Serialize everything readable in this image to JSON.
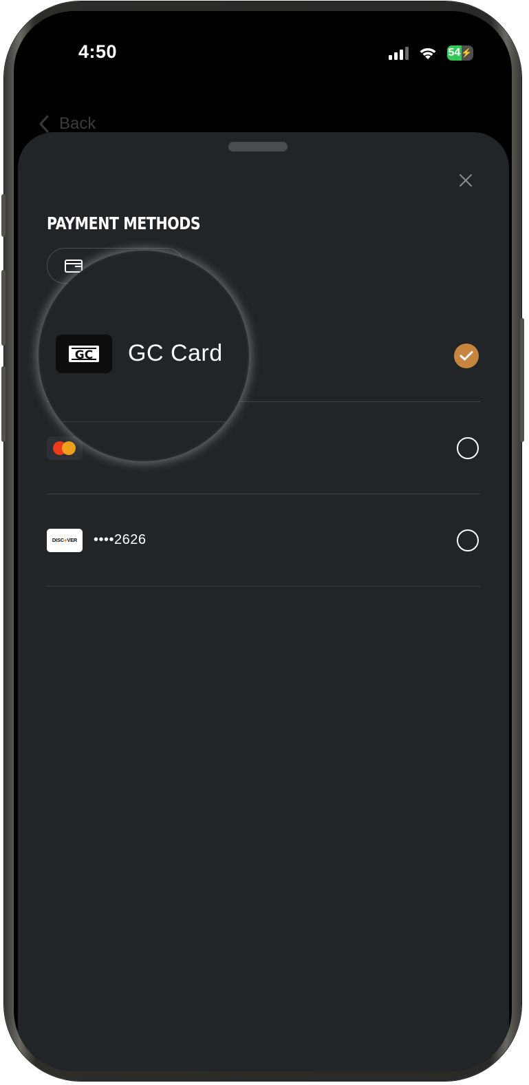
{
  "status_bar": {
    "time": "4:50",
    "battery": "54"
  },
  "nav": {
    "back_label": "Back"
  },
  "sheet": {
    "title": "PAYMENT METHODS",
    "close_icon": "close-icon",
    "add_icon": "wallet-icon"
  },
  "payment_methods": [
    {
      "brand": "GC Card",
      "label": "GC Card",
      "logo_text": "GC",
      "selected": true
    },
    {
      "brand": "mastercard",
      "label": "",
      "selected": false
    },
    {
      "brand": "discover",
      "logo_text": "DISCOVER",
      "label": "••••2626",
      "selected": false
    }
  ],
  "colors": {
    "sheet_bg": "#222528",
    "accent_check": "#c78640",
    "battery_green": "#34c759"
  }
}
